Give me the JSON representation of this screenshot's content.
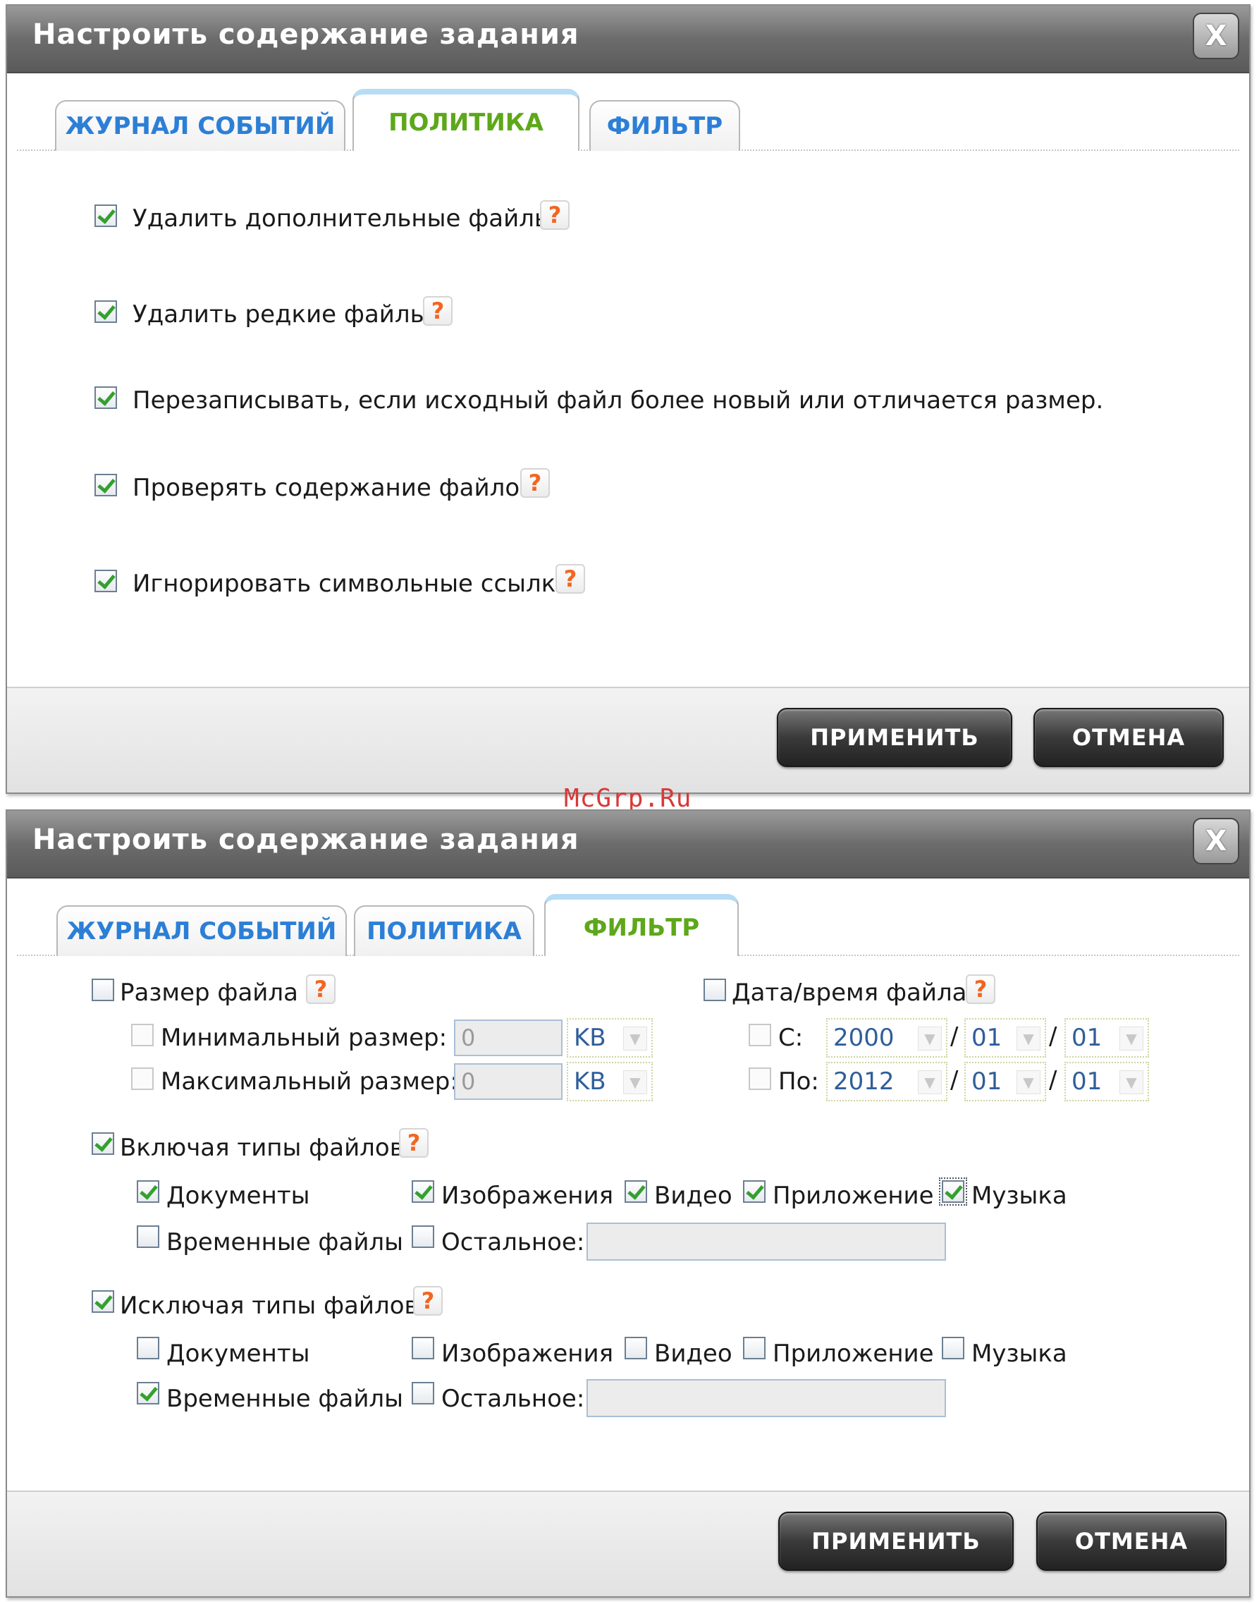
{
  "dialog_title": "Настроить содержание задания",
  "close_glyph": "X",
  "tabs": {
    "events": "ЖУРНАЛ СОБЫТИЙ",
    "policy": "ПОЛИТИКА",
    "filter": "ФИЛЬТР"
  },
  "buttons": {
    "apply": "ПРИМЕНИТЬ",
    "cancel": "ОТМЕНА"
  },
  "help_glyph": "?",
  "watermark": "McGrp.Ru",
  "policy": {
    "delete_extra": "Удалить дополнительные файлы",
    "delete_sparse": "Удалить редкие файлы",
    "overwrite": "Перезаписывать, если исходный файл более новый или отличается размер.",
    "verify": "Проверять содержание файлов",
    "ignore_symlinks": "Игнорировать символьные ссылки"
  },
  "filter": {
    "size": {
      "label": "Размер файла",
      "min_label": "Минимальный размер:",
      "max_label": "Максимальный размер:",
      "min_value": "0",
      "max_value": "0",
      "unit": "KB"
    },
    "date": {
      "label": "Дата/время файла",
      "from_label": "С:",
      "to_label": "По:",
      "from": {
        "year": "2000",
        "month": "01",
        "day": "01"
      },
      "to": {
        "year": "2012",
        "month": "01",
        "day": "01"
      },
      "sep": "/"
    },
    "include": {
      "label": "Включая типы файлов",
      "documents": "Документы",
      "images": "Изображения",
      "video": "Видео",
      "app": "Приложение",
      "music": "Музыка",
      "temp": "Временные файлы",
      "other": "Остальное:"
    },
    "exclude": {
      "label": "Исключая типы файлов",
      "documents": "Документы",
      "images": "Изображения",
      "video": "Видео",
      "app": "Приложение",
      "music": "Музыка",
      "temp": "Временные файлы",
      "other": "Остальное:"
    }
  }
}
